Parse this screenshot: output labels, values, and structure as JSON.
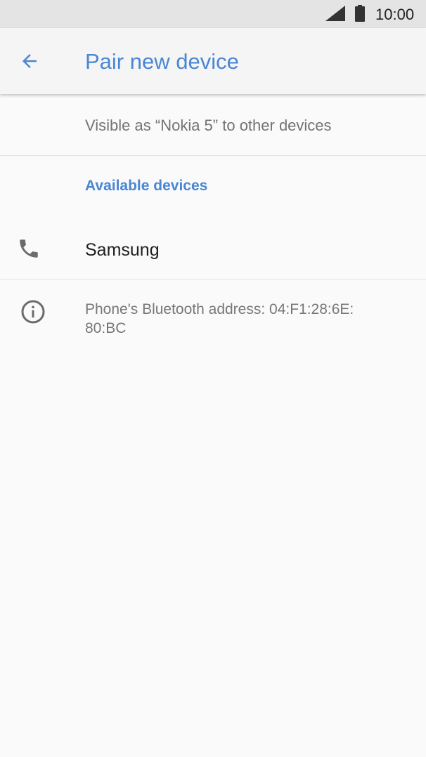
{
  "status_bar": {
    "time": "10:00",
    "signal_icon": "cell-signal-icon",
    "battery_icon": "battery-icon"
  },
  "app_bar": {
    "back_icon": "arrow-back-icon",
    "title": "Pair new device"
  },
  "visibility_text": "Visible as “Nokia 5” to other devices",
  "available_devices": {
    "header": "Available devices",
    "items": [
      {
        "name": "Samsung",
        "icon": "phone-icon"
      }
    ]
  },
  "info": {
    "icon": "info-icon",
    "text": "Phone's Bluetooth address: 04:F1:28:6E:\n80:BC"
  },
  "colors": {
    "accent": "#4a86d4",
    "status_bar": "#e4e4e4",
    "background": "#fafafa",
    "secondary_text": "#737373",
    "icon_gray": "#6b6b6b"
  }
}
